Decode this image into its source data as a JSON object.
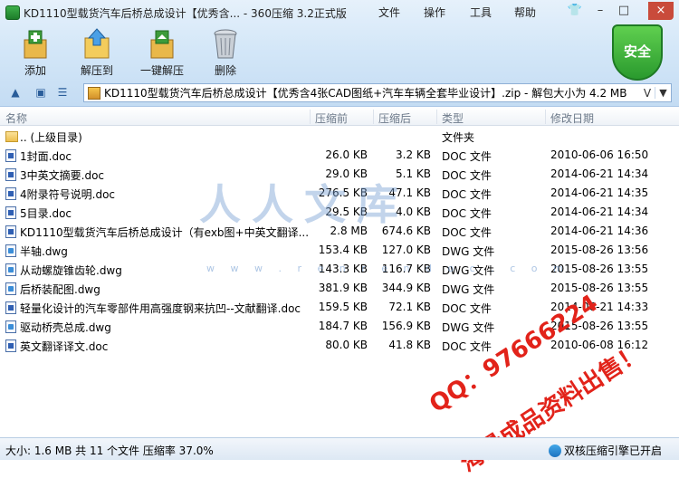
{
  "window": {
    "title": "KD1110型载货汽车后桥总成设计【优秀含... - 360压缩 3.2正式版",
    "menu": [
      "文件",
      "操作",
      "工具",
      "帮助"
    ],
    "controls": {
      "skin": "👕",
      "minimize": "–",
      "maximize": "□",
      "close": "×"
    }
  },
  "toolbar": {
    "buttons": [
      {
        "label": "添加",
        "icon": "add-archive-icon"
      },
      {
        "label": "解压到",
        "icon": "extract-to-icon"
      },
      {
        "label": "一键解压",
        "icon": "one-click-extract-icon"
      },
      {
        "label": "删除",
        "icon": "delete-trash-icon"
      }
    ],
    "security_badge": "安全"
  },
  "address": {
    "path": "KD1110型载货汽车后桥总成设计【优秀含4张CAD图纸+汽车车辆全套毕业设计】.zip - 解包大小为 4.2 MB",
    "v_label": "V",
    "dropdown": "▼"
  },
  "columns": [
    "名称",
    "压缩前",
    "压缩后",
    "类型",
    "修改日期"
  ],
  "files": [
    {
      "name": ".. (上级目录)",
      "size": "",
      "packed": "",
      "type": "文件夹",
      "date": "",
      "kind": "folder"
    },
    {
      "name": "1封面.doc",
      "size": "26.0 KB",
      "packed": "3.2 KB",
      "type": "DOC 文件",
      "date": "2010-06-06 16:50",
      "kind": "doc"
    },
    {
      "name": "3中英文摘要.doc",
      "size": "29.0 KB",
      "packed": "5.1 KB",
      "type": "DOC 文件",
      "date": "2014-06-21 14:34",
      "kind": "doc"
    },
    {
      "name": "4附录符号说明.doc",
      "size": "276.5 KB",
      "packed": "47.1 KB",
      "type": "DOC 文件",
      "date": "2014-06-21 14:35",
      "kind": "doc"
    },
    {
      "name": "5目录.doc",
      "size": "29.5 KB",
      "packed": "4.0 KB",
      "type": "DOC 文件",
      "date": "2014-06-21 14:34",
      "kind": "doc"
    },
    {
      "name": "KD1110型载货汽车后桥总成设计（有exb图+中英文翻译...",
      "size": "2.8 MB",
      "packed": "674.6 KB",
      "type": "DOC 文件",
      "date": "2014-06-21 14:36",
      "kind": "doc"
    },
    {
      "name": "半轴.dwg",
      "size": "153.4 KB",
      "packed": "127.0 KB",
      "type": "DWG 文件",
      "date": "2015-08-26 13:56",
      "kind": "dwg"
    },
    {
      "name": "从动螺旋锥齿轮.dwg",
      "size": "143.3 KB",
      "packed": "116.7 KB",
      "type": "DWG 文件",
      "date": "2015-08-26 13:55",
      "kind": "dwg"
    },
    {
      "name": "后桥装配图.dwg",
      "size": "381.9 KB",
      "packed": "344.9 KB",
      "type": "DWG 文件",
      "date": "2015-08-26 13:55",
      "kind": "dwg"
    },
    {
      "name": "轻量化设计的汽车零部件用高强度钢来抗凹--文献翻译.doc",
      "size": "159.5 KB",
      "packed": "72.1 KB",
      "type": "DOC 文件",
      "date": "2014-06-21 14:33",
      "kind": "doc"
    },
    {
      "name": "驱动桥壳总成.dwg",
      "size": "184.7 KB",
      "packed": "156.9 KB",
      "type": "DWG 文件",
      "date": "2015-08-26 13:55",
      "kind": "dwg"
    },
    {
      "name": "英文翻译译文.doc",
      "size": "80.0 KB",
      "packed": "41.8 KB",
      "type": "DOC 文件",
      "date": "2010-06-08 16:12",
      "kind": "doc"
    }
  ],
  "watermark": {
    "logo_text": "人人文库",
    "url_text": "w w w . r e n r e n d o c . c o m",
    "qq": "QQ：97666224",
    "slogan": "海量成品资料出售！"
  },
  "status": {
    "summary": "大小: 1.6 MB 共 11 个文件 压缩率 37.0%",
    "engine": "双核压缩引擎已开启"
  }
}
